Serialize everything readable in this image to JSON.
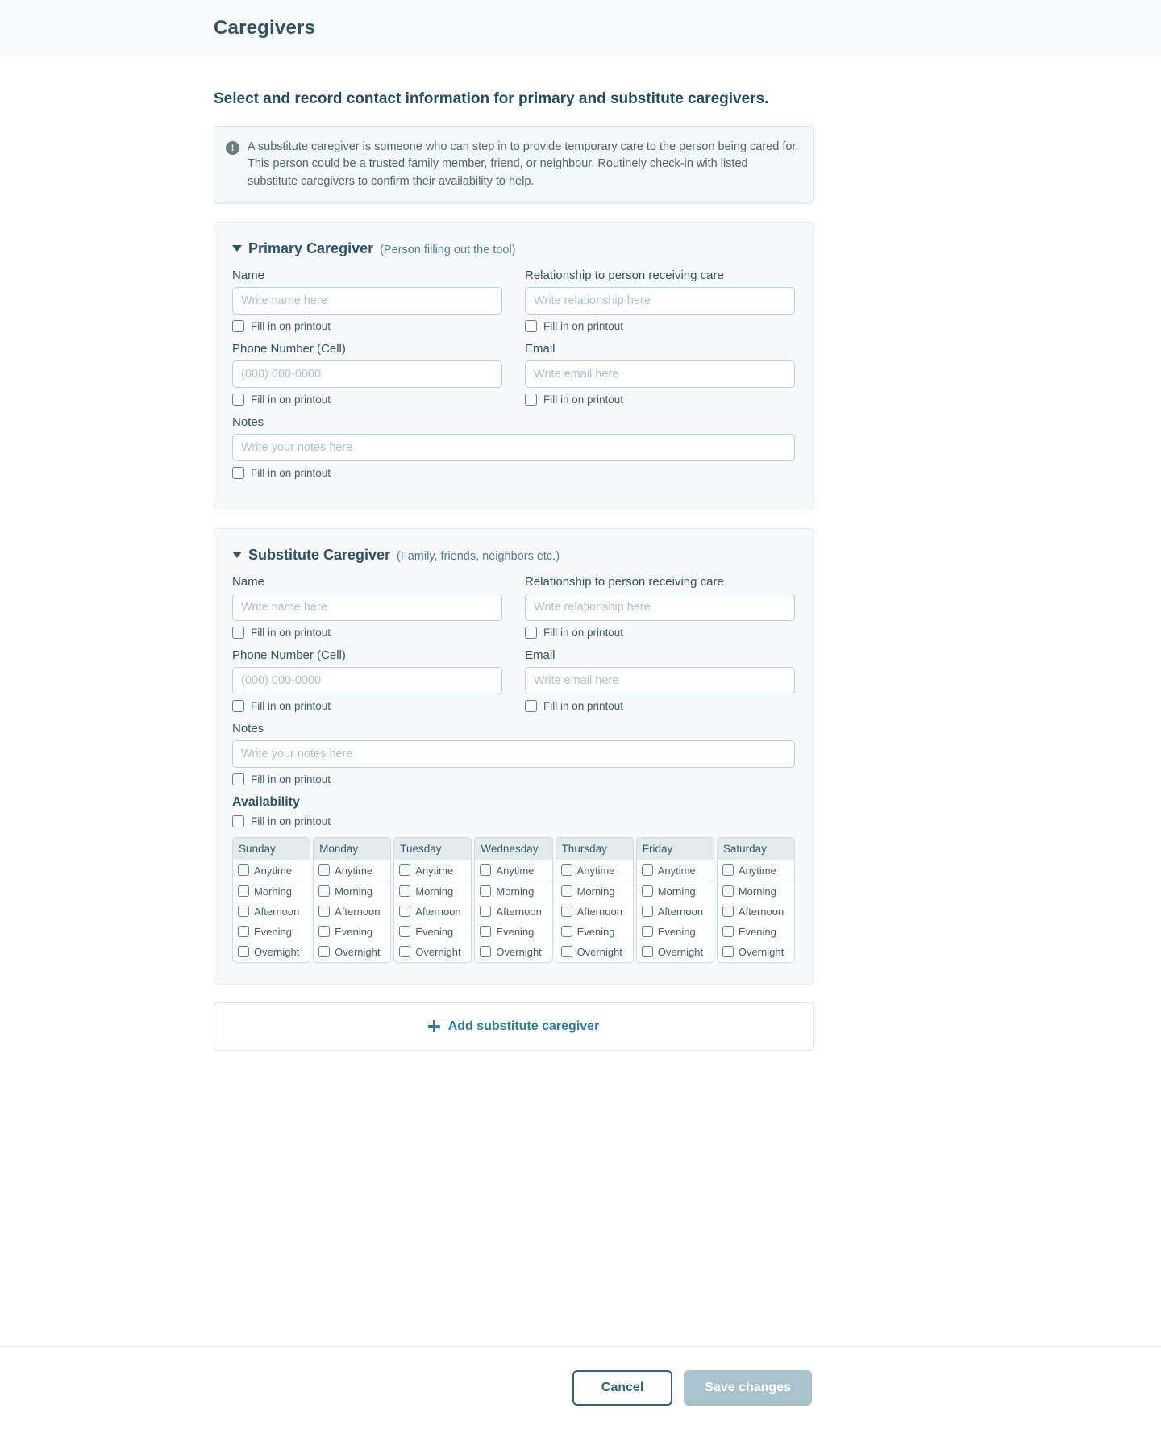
{
  "topbar": {
    "title": "Caregivers"
  },
  "page": {
    "heading": "Select and record contact information for primary and substitute caregivers.",
    "callout": {
      "icon": "info-exclamation-icon",
      "text": "A substitute caregiver is someone who can step in to provide temporary care to the person being cared for. This person could be a trusted family member, friend, or neighbour. Routinely check-in with listed substitute caregivers to confirm their availability to help."
    }
  },
  "labels": {
    "name": "Name",
    "relationship": "Relationship to person receiving care",
    "phone": "Phone Number (Cell)",
    "email": "Email",
    "notes": "Notes",
    "availability": "Availability",
    "fill_in_on_printout": "Fill in on printout"
  },
  "placeholders": {
    "name": "Write name here",
    "relationship": "Write relationship here",
    "phone": "(000) 000-0000",
    "email": "Write email here",
    "notes": "Write your notes here"
  },
  "values": {
    "primary_name": "",
    "primary_relationship": "",
    "primary_phone": "",
    "primary_email": "",
    "primary_notes": "",
    "substitute_name": "",
    "substitute_relationship": "",
    "substitute_phone": "",
    "substitute_email": "",
    "substitute_notes": ""
  },
  "primary": {
    "title": "Primary Caregiver",
    "subtitle": "(Person filling out the tool)"
  },
  "substitute": {
    "title": "Substitute Caregiver",
    "subtitle": "(Family, friends, neighbors etc.)"
  },
  "availability": {
    "days": [
      "Sunday",
      "Monday",
      "Tuesday",
      "Wednesday",
      "Thursday",
      "Friday",
      "Saturday"
    ],
    "slots": [
      "Anytime",
      "Morning",
      "Afternoon",
      "Evening",
      "Overnight"
    ]
  },
  "add_button": {
    "label": "Add substitute caregiver",
    "icon": "plus-icon"
  },
  "footer": {
    "cancel_label": "Cancel",
    "save_label": "Save changes"
  },
  "colors": {
    "accent": "#2b7ea1",
    "heading": "#2b5468",
    "border": "#b7d2db",
    "card_bg": "#f6f8f9",
    "callout_bg": "#f2f7f8",
    "save_disabled": "#a8c3cd"
  }
}
